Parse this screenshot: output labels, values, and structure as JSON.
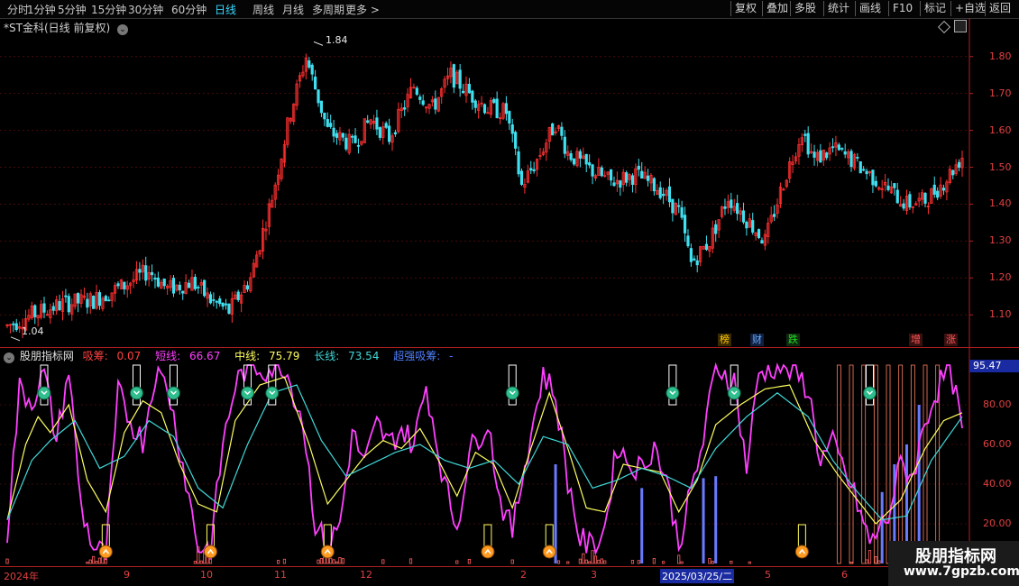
{
  "toolbar": {
    "periods": [
      "分时",
      "1分钟",
      "5分钟",
      "15分钟",
      "30分钟",
      "60分钟",
      "日线",
      "周线",
      "月线",
      "多周期",
      "更多 >"
    ],
    "active_period": "日线",
    "right_buttons": [
      "复权",
      "叠加",
      "多股",
      "统计",
      "画线",
      "F10",
      "标记",
      "+自选",
      "返回"
    ]
  },
  "upper_title": "*ST金科(日线 前复权)",
  "upper_price_labels": {
    "high": "1.84",
    "low": "1.04"
  },
  "upper_axis_ticks": [
    "1.80",
    "1.70",
    "1.60",
    "1.50",
    "1.40",
    "1.30",
    "1.20",
    "1.10"
  ],
  "event_labels": [
    {
      "text": "榜",
      "color": "#ffcc00",
      "bg": "#3a2a00"
    },
    {
      "text": "财",
      "color": "#66aaff",
      "bg": "#102040"
    },
    {
      "text": "跌",
      "color": "#22dd22",
      "bg": "#0f2a0f"
    },
    {
      "text": "增",
      "color": "#ff5555",
      "bg": "#3a1010"
    },
    {
      "text": "涨",
      "color": "#ff5555",
      "bg": "#3a1010"
    }
  ],
  "indicator": {
    "name": "股朋指标网",
    "absorb": {
      "label": "吸筹:",
      "value": "0.07",
      "color": "#ff4040"
    },
    "short": {
      "label": "短线:",
      "value": "66.67",
      "color": "#ff40ff"
    },
    "mid": {
      "label": "中线:",
      "value": "75.79",
      "color": "#ffff60"
    },
    "long": {
      "label": "长线:",
      "value": "73.54",
      "color": "#40d8d8"
    },
    "super": {
      "label": "超强吸筹:",
      "value": "-",
      "color": "#5080ff"
    },
    "current_value": "95.47",
    "axis_ticks": [
      "80.00",
      "60.00",
      "40.00",
      "20.00"
    ]
  },
  "date_axis": [
    "2024年",
    "9",
    "10",
    "11",
    "12",
    "2",
    "3",
    "2025/03/25/二",
    "5",
    "6"
  ],
  "watermark": {
    "title": "股朋指标网",
    "url": "www.7gpzb.com"
  },
  "chart_data": [
    {
      "type": "candlestick",
      "title": "*ST金科(日线 前复权)",
      "ylim": [
        1.02,
        1.88
      ],
      "annotations": [
        {
          "text": "1.84",
          "value": 1.84
        },
        {
          "text": "1.04",
          "value": 1.04
        }
      ],
      "waypoints": [
        [
          0,
          1.07
        ],
        [
          8,
          1.1
        ],
        [
          18,
          1.13
        ],
        [
          28,
          1.14
        ],
        [
          38,
          1.18
        ],
        [
          46,
          1.22
        ],
        [
          52,
          1.17
        ],
        [
          60,
          1.19
        ],
        [
          66,
          1.14
        ],
        [
          72,
          1.11
        ],
        [
          79,
          1.2
        ],
        [
          86,
          1.42
        ],
        [
          92,
          1.65
        ],
        [
          97,
          1.8
        ],
        [
          104,
          1.6
        ],
        [
          112,
          1.56
        ],
        [
          118,
          1.63
        ],
        [
          124,
          1.58
        ],
        [
          132,
          1.72
        ],
        [
          138,
          1.66
        ],
        [
          144,
          1.75
        ],
        [
          150,
          1.7
        ],
        [
          156,
          1.66
        ],
        [
          162,
          1.65
        ],
        [
          167,
          1.45
        ],
        [
          172,
          1.52
        ],
        [
          178,
          1.62
        ],
        [
          182,
          1.54
        ],
        [
          188,
          1.5
        ],
        [
          196,
          1.46
        ],
        [
          204,
          1.48
        ],
        [
          212,
          1.44
        ],
        [
          218,
          1.38
        ],
        [
          222,
          1.24
        ],
        [
          228,
          1.3
        ],
        [
          234,
          1.42
        ],
        [
          240,
          1.36
        ],
        [
          246,
          1.3
        ],
        [
          252,
          1.46
        ],
        [
          258,
          1.6
        ],
        [
          262,
          1.52
        ],
        [
          268,
          1.55
        ],
        [
          274,
          1.52
        ],
        [
          280,
          1.48
        ],
        [
          286,
          1.44
        ],
        [
          292,
          1.4
        ],
        [
          298,
          1.41
        ],
        [
          304,
          1.46
        ],
        [
          310,
          1.53
        ]
      ]
    },
    {
      "type": "line",
      "title": "股朋指标网",
      "ylim": [
        0,
        100
      ],
      "series": [
        {
          "name": "短线",
          "color": "#ff40ff",
          "waypoints": [
            [
              0,
              16
            ],
            [
              4,
              88
            ],
            [
              8,
              82
            ],
            [
              12,
              96
            ],
            [
              16,
              62
            ],
            [
              20,
              98
            ],
            [
              24,
              28
            ],
            [
              28,
              8
            ],
            [
              32,
              4
            ],
            [
              36,
              86
            ],
            [
              40,
              72
            ],
            [
              44,
              62
            ],
            [
              48,
              96
            ],
            [
              52,
              90
            ],
            [
              58,
              42
            ],
            [
              62,
              8
            ],
            [
              66,
              8
            ],
            [
              70,
              60
            ],
            [
              74,
              90
            ],
            [
              78,
              100
            ],
            [
              84,
              98
            ],
            [
              90,
              100
            ],
            [
              96,
              72
            ],
            [
              100,
              20
            ],
            [
              104,
              8
            ],
            [
              108,
              20
            ],
            [
              112,
              66
            ],
            [
              116,
              50
            ],
            [
              120,
              70
            ],
            [
              124,
              60
            ],
            [
              128,
              68
            ],
            [
              132,
              60
            ],
            [
              136,
              90
            ],
            [
              142,
              40
            ],
            [
              146,
              18
            ],
            [
              150,
              56
            ],
            [
              156,
              72
            ],
            [
              160,
              32
            ],
            [
              164,
              16
            ],
            [
              168,
              50
            ],
            [
              174,
              96
            ],
            [
              178,
              84
            ],
            [
              182,
              42
            ],
            [
              186,
              12
            ],
            [
              190,
              8
            ],
            [
              194,
              18
            ],
            [
              198,
              60
            ],
            [
              202,
              50
            ],
            [
              206,
              48
            ],
            [
              210,
              60
            ],
            [
              214,
              42
            ],
            [
              218,
              10
            ],
            [
              222,
              36
            ],
            [
              226,
              62
            ],
            [
              230,
              100
            ],
            [
              236,
              92
            ],
            [
              240,
              48
            ],
            [
              244,
              96
            ],
            [
              250,
              100
            ],
            [
              256,
              96
            ],
            [
              260,
              88
            ],
            [
              264,
              52
            ],
            [
              268,
              60
            ],
            [
              272,
              46
            ],
            [
              276,
              30
            ],
            [
              280,
              10
            ],
            [
              286,
              24
            ],
            [
              290,
              50
            ],
            [
              294,
              44
            ],
            [
              298,
              72
            ],
            [
              302,
              88
            ],
            [
              306,
              100
            ],
            [
              310,
              67
            ]
          ]
        },
        {
          "name": "中线",
          "color": "#ffff60",
          "waypoints": [
            [
              0,
              22
            ],
            [
              6,
              60
            ],
            [
              10,
              74
            ],
            [
              14,
              66
            ],
            [
              20,
              80
            ],
            [
              26,
              42
            ],
            [
              32,
              26
            ],
            [
              38,
              66
            ],
            [
              44,
              82
            ],
            [
              50,
              76
            ],
            [
              56,
              50
            ],
            [
              62,
              30
            ],
            [
              68,
              26
            ],
            [
              74,
              72
            ],
            [
              82,
              90
            ],
            [
              90,
              94
            ],
            [
              98,
              60
            ],
            [
              104,
              30
            ],
            [
              110,
              42
            ],
            [
              116,
              54
            ],
            [
              122,
              62
            ],
            [
              128,
              58
            ],
            [
              134,
              68
            ],
            [
              140,
              52
            ],
            [
              146,
              34
            ],
            [
              152,
              56
            ],
            [
              158,
              50
            ],
            [
              164,
              28
            ],
            [
              170,
              58
            ],
            [
              176,
              86
            ],
            [
              182,
              58
            ],
            [
              188,
              28
            ],
            [
              194,
              26
            ],
            [
              200,
              50
            ],
            [
              206,
              48
            ],
            [
              212,
              46
            ],
            [
              218,
              26
            ],
            [
              224,
              42
            ],
            [
              230,
              70
            ],
            [
              238,
              80
            ],
            [
              246,
              88
            ],
            [
              254,
              90
            ],
            [
              262,
              62
            ],
            [
              270,
              44
            ],
            [
              276,
              32
            ],
            [
              282,
              20
            ],
            [
              290,
              32
            ],
            [
              298,
              58
            ],
            [
              304,
              72
            ],
            [
              310,
              76
            ]
          ]
        },
        {
          "name": "长线",
          "color": "#40d8d8",
          "waypoints": [
            [
              0,
              22
            ],
            [
              8,
              52
            ],
            [
              14,
              62
            ],
            [
              22,
              72
            ],
            [
              30,
              48
            ],
            [
              38,
              54
            ],
            [
              46,
              72
            ],
            [
              54,
              64
            ],
            [
              62,
              38
            ],
            [
              70,
              28
            ],
            [
              78,
              60
            ],
            [
              86,
              86
            ],
            [
              94,
              90
            ],
            [
              102,
              62
            ],
            [
              110,
              44
            ],
            [
              118,
              50
            ],
            [
              126,
              56
            ],
            [
              134,
              60
            ],
            [
              142,
              52
            ],
            [
              150,
              48
            ],
            [
              158,
              52
            ],
            [
              166,
              40
            ],
            [
              174,
              64
            ],
            [
              182,
              60
            ],
            [
              190,
              38
            ],
            [
              198,
              42
            ],
            [
              206,
              48
            ],
            [
              214,
              44
            ],
            [
              222,
              38
            ],
            [
              230,
              58
            ],
            [
              240,
              74
            ],
            [
              250,
              86
            ],
            [
              260,
              74
            ],
            [
              268,
              52
            ],
            [
              276,
              36
            ],
            [
              284,
              22
            ],
            [
              292,
              24
            ],
            [
              300,
              52
            ],
            [
              310,
              74
            ]
          ]
        }
      ],
      "absorb_markers_green": [
        12,
        42,
        54,
        78,
        86,
        164,
        216,
        236,
        280
      ],
      "absorb_markers_orange": [
        32,
        66,
        104,
        156,
        176,
        258
      ]
    }
  ]
}
